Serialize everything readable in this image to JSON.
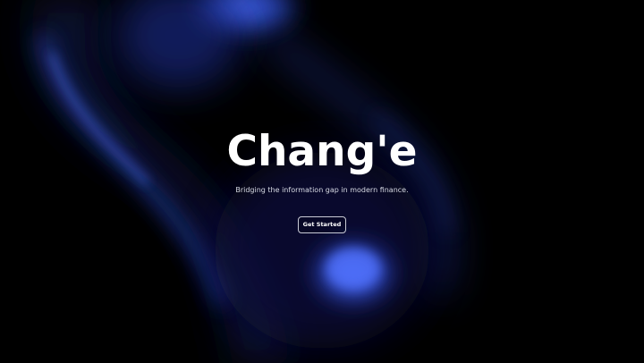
{
  "hero": {
    "title": "Chang'e",
    "subtitle": "Bridging the information gap in modern finance.",
    "cta_label": "Get Started"
  },
  "colors": {
    "background": "#000000",
    "accent_blue": "#3f63f0",
    "text": "#ffffff"
  }
}
